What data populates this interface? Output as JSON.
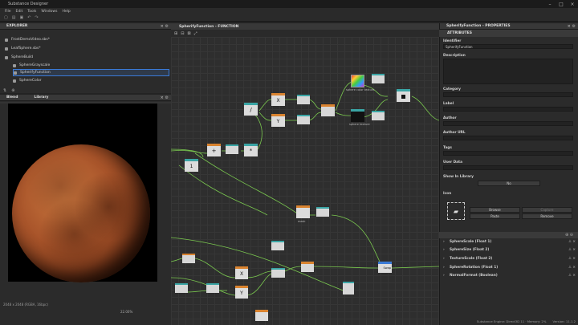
{
  "window": {
    "title": "Substance Designer"
  },
  "menu": [
    "File",
    "Edit",
    "Tools",
    "Windows",
    "Help"
  ],
  "explorer": {
    "title": "EXPLORER",
    "items": [
      {
        "label": "FrostDemoVideo.sbs*"
      },
      {
        "label": "LeafSphere.sbs*"
      },
      {
        "label": "SphereBuild"
      },
      {
        "label": "SphereGrayscale"
      },
      {
        "label": "SpherifyFunction"
      },
      {
        "label": "SphereColor"
      }
    ]
  },
  "viewer": {
    "tabs": [
      "Blend",
      "Library"
    ],
    "resolution": "2048 x 2048 (RGBA, 16bpc)",
    "zoom": "22.00%"
  },
  "graph": {
    "title": "SpherifyFunction - FUNCTION",
    "node_labels": {
      "divide": "/",
      "plus": "+",
      "mult": "*",
      "one": "1",
      "x_top": "X",
      "y_top": "Y",
      "x_bot": "X",
      "y_bot": "Y",
      "sphere_label": "sphere color texture",
      "sample_label": "sphere texture",
      "swap_label": "Swap",
      "small_label": "mask"
    }
  },
  "properties": {
    "title": "SpherifyFunction - PROPERTIES",
    "section": "ATTRIBUTES",
    "identifier_label": "Identifier",
    "identifier_value": "SpherifyFunction",
    "description_label": "Description",
    "category_label": "Category",
    "label_label": "Label",
    "author_label": "Author",
    "author_url_label": "Author URL",
    "tags_label": "Tags",
    "user_data_label": "User Data",
    "show_in_library_label": "Show In Library",
    "show_in_library_value": "No",
    "icon_label": "Icon",
    "buttons": {
      "browse": "Browse",
      "capture": "Capture",
      "paste": "Paste",
      "remove": "Remove"
    },
    "inputs": [
      {
        "label": "SphereScale (Float 1)"
      },
      {
        "label": "SphereSize (Float 2)"
      },
      {
        "label": "TextureScale (Float 2)"
      },
      {
        "label": "SphereRotation (Float 1)"
      },
      {
        "label": "NormalFormat (Boolean)"
      }
    ]
  },
  "status": {
    "engine": "Substance Engine: Direct3D 11 · Memory: 2%",
    "version": "Version: 11.1.2"
  },
  "colors": {
    "accent": "#3a7ad6",
    "node_header_orange": "#d9832f",
    "node_header_teal": "#3aa5a5",
    "link": "#6fbf5a"
  }
}
